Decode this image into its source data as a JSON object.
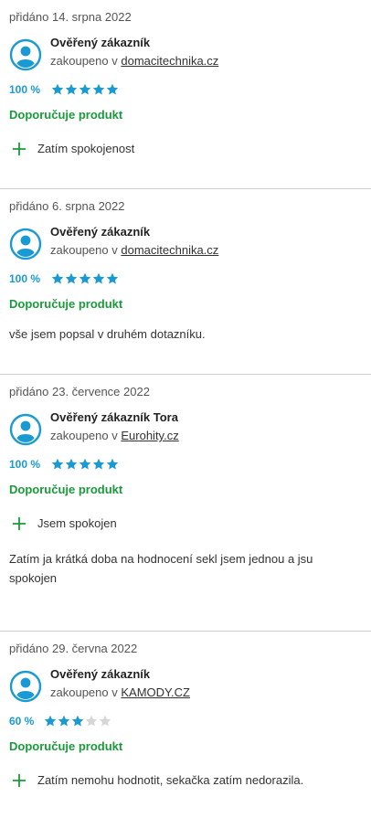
{
  "reviews": [
    {
      "date": "přidáno 14. srpna 2022",
      "author": "Ověřený zákazník",
      "purchased_prefix": "zakoupeno v",
      "store": "domacitechnika.cz",
      "rating_pct": "100 %",
      "stars_filled": 5,
      "recommend": "Doporučuje produkt",
      "pro": "Zatím spokojenost",
      "text": ""
    },
    {
      "date": "přidáno 6. srpna 2022",
      "author": "Ověřený zákazník",
      "purchased_prefix": "zakoupeno v",
      "store": "domacitechnika.cz",
      "rating_pct": "100 %",
      "stars_filled": 5,
      "recommend": "Doporučuje produkt",
      "pro": "",
      "text": "vše jsem popsal v druhém dotazníku."
    },
    {
      "date": "přidáno 23. července 2022",
      "author": "Ověřený zákazník Tora",
      "purchased_prefix": "zakoupeno v",
      "store": "Eurohity.cz",
      "rating_pct": "100 %",
      "stars_filled": 5,
      "recommend": "Doporučuje produkt",
      "pro": "Jsem spokojen",
      "text": "Zatím ja krátká doba na hodnocení sekl jsem jednou a jsu spokojen"
    },
    {
      "date": "přidáno 29. června 2022",
      "author": "Ověřený zákazník",
      "purchased_prefix": "zakoupeno v",
      "store": "KAMODY.CZ",
      "rating_pct": "60 %",
      "stars_filled": 3,
      "recommend": "Doporučuje produkt",
      "pro": "Zatím nemohu hodnotit, sekačka zatím nedorazila.",
      "text": ""
    }
  ],
  "colors": {
    "rating": "#1a9ad3",
    "star_filled": "#1a9ad3",
    "star_empty": "#d6d6d6",
    "recommend": "#1a9a3a",
    "plus": "#1a9a3a",
    "avatar": "#1a9ad3"
  },
  "icons": {
    "avatar": "user-avatar-icon",
    "star": "star-icon",
    "plus": "plus-icon"
  }
}
